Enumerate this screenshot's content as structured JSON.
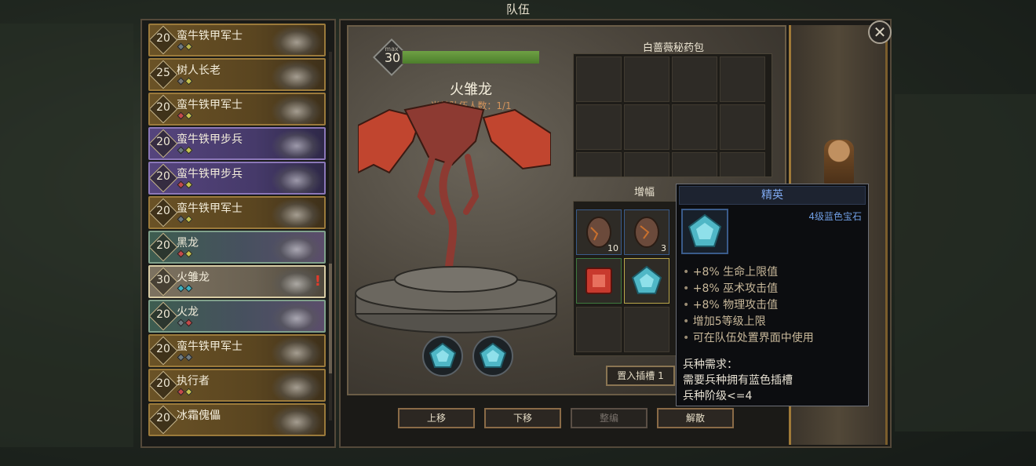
{
  "window": {
    "title": "队伍",
    "close_icon": "close-icon"
  },
  "roster": [
    {
      "name": "蛮牛铁甲军士",
      "level": "20",
      "rarity": "gold",
      "gems": [
        "#6e7a80",
        "#b9b34a"
      ]
    },
    {
      "name": "树人长老",
      "level": "25",
      "rarity": "gold",
      "gems": [
        "#7a7a7a",
        "#c5c24f"
      ]
    },
    {
      "name": "蛮牛铁甲军士",
      "level": "20",
      "rarity": "gold",
      "gems": [
        "#c44a4a",
        "#c5c24f"
      ]
    },
    {
      "name": "蛮牛铁甲步兵",
      "level": "20",
      "rarity": "blue",
      "gems": [
        "#6e7a80",
        "#c5c24f"
      ]
    },
    {
      "name": "蛮牛铁甲步兵",
      "level": "20",
      "rarity": "blue",
      "gems": [
        "#c44a4a",
        "#c5c24f"
      ]
    },
    {
      "name": "蛮牛铁甲军士",
      "level": "20",
      "rarity": "gold",
      "gems": [
        "#6e7a80",
        "#c5c24f"
      ]
    },
    {
      "name": "黑龙",
      "level": "20",
      "rarity": "green",
      "gems": [
        "#c44a4a",
        "#c5c24f"
      ]
    },
    {
      "name": "火雏龙",
      "level": "30",
      "rarity": "selected",
      "gems": [
        "#3fb0c0",
        "#3fb0c0"
      ],
      "warning": "!"
    },
    {
      "name": "火龙",
      "level": "20",
      "rarity": "green",
      "gems": [
        "#6e7a80",
        "#c44a4a"
      ]
    },
    {
      "name": "蛮牛铁甲军士",
      "level": "20",
      "rarity": "gold",
      "gems": [
        "#6e7a80",
        "#6e7a80"
      ]
    },
    {
      "name": "执行者",
      "level": "20",
      "rarity": "gold",
      "gems": [
        "#c44a4a",
        "#c5c24f"
      ]
    },
    {
      "name": "冰霜傀儡",
      "level": "20",
      "rarity": "gold",
      "gems": []
    }
  ],
  "unit": {
    "name": "火雏龙",
    "level": "30",
    "level_max_label": "max",
    "xp_fraction": 1.0,
    "party_count": "当前队伍人数：1/1"
  },
  "potion_bag": {
    "title": "白蔷薇秘药包"
  },
  "amplify": {
    "title": "增幅",
    "items": [
      {
        "type": "egg",
        "count": "10"
      },
      {
        "type": "egg",
        "count": "3"
      },
      {
        "type": "red-gem",
        "count": ""
      },
      {
        "type": "blue-gem",
        "count": ""
      }
    ],
    "insert_button": "置入插槽 1"
  },
  "buttons": {
    "move_up": "上移",
    "move_down": "下移",
    "organize": "整编",
    "disband": "解散"
  },
  "tooltip": {
    "quality": "精英",
    "item_name": "4级蓝色宝石",
    "stats": [
      "+8% 生命上限值",
      "+8% 巫术攻击值",
      "+8% 物理攻击值",
      "增加5等级上限",
      "可在队伍处置界面中使用"
    ],
    "requirement_title": "兵种需求：",
    "requirement_1": "需要兵种拥有蓝色插槽",
    "requirement_2": "兵种阶级<=4"
  },
  "colors": {
    "gem_blue": "#4fb7c6",
    "gem_red": "#c83a2e",
    "tooltip_title": "#7fa9f0",
    "party_count": "#d4945c"
  }
}
